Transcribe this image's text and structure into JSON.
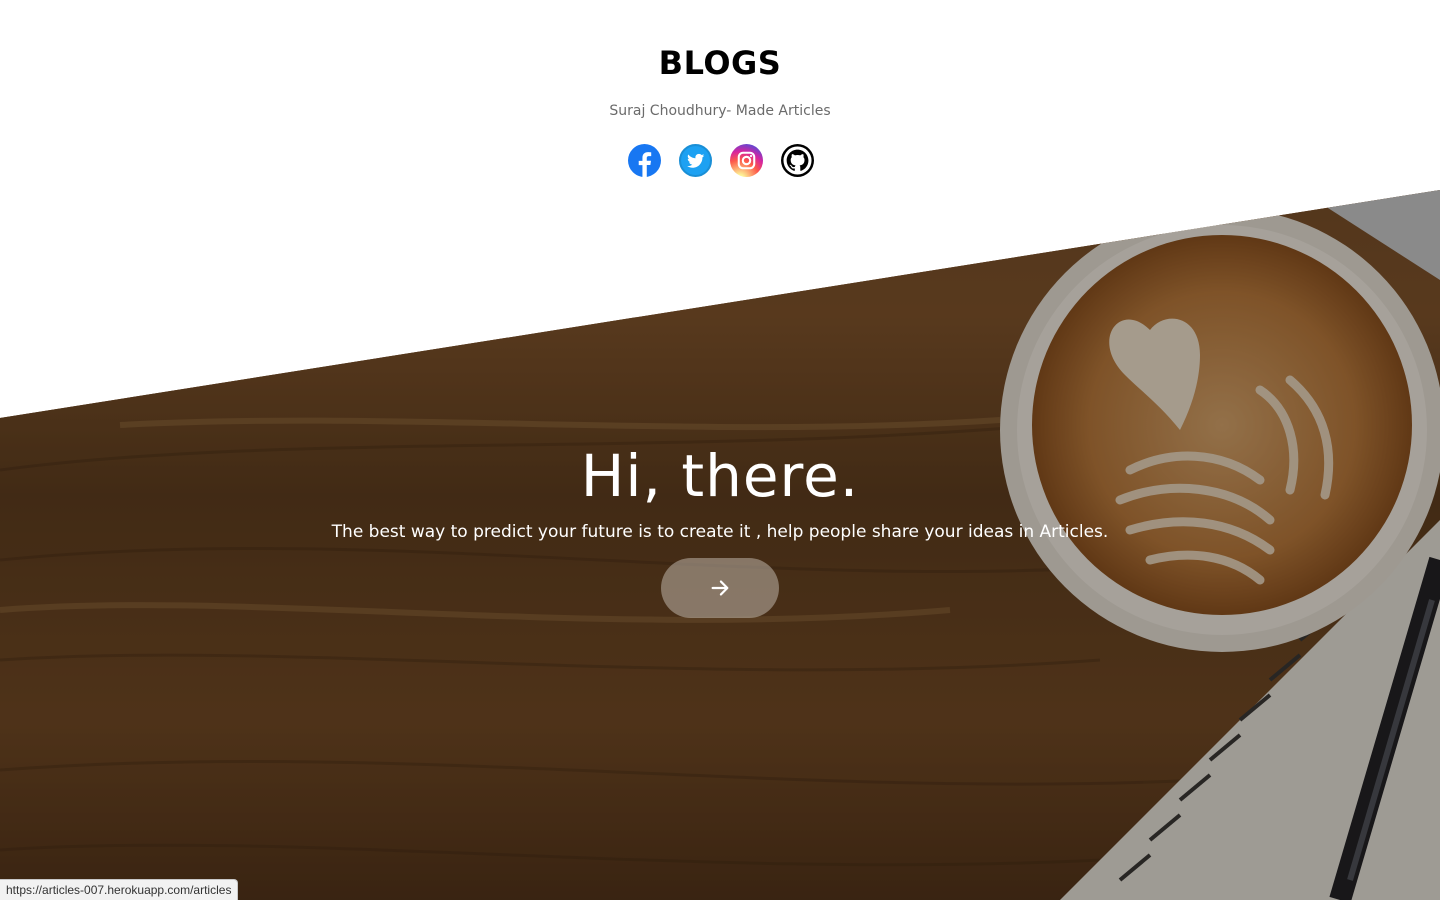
{
  "header": {
    "title": "BLOGS",
    "subtitle": "Suraj Choudhury- Made Articles"
  },
  "social": [
    {
      "name": "facebook",
      "icon": "facebook-icon",
      "color": "#1877f2"
    },
    {
      "name": "twitter",
      "icon": "twitter-icon",
      "color": "#1da1f2"
    },
    {
      "name": "instagram",
      "icon": "instagram-icon",
      "color": "#e1306c"
    },
    {
      "name": "github",
      "icon": "github-icon",
      "color": "#000000"
    }
  ],
  "hero": {
    "title": "Hi, there.",
    "text": "The best way to predict your future is to create it , help people share your ideas in Articles.",
    "button_icon": "arrow-right-icon"
  },
  "status_bar": {
    "url": "https://articles-007.herokuapp.com/articles"
  }
}
